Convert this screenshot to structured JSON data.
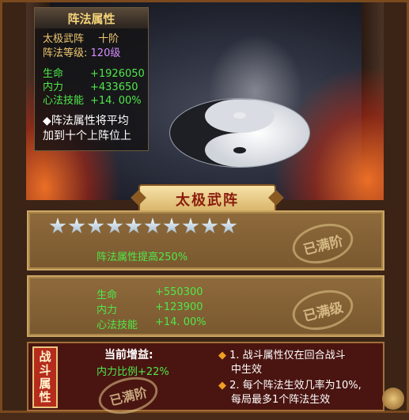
{
  "info_panel": {
    "header": "阵法属性",
    "formation_name": "太极武阵",
    "formation_rank": "十阶",
    "level_label": "阵法等级:",
    "level_value": "120级",
    "stats": [
      {
        "label": "生命",
        "value": "+1926050"
      },
      {
        "label": "内力",
        "value": "+433650"
      },
      {
        "label": "心法技能",
        "value": "+14. 00%"
      }
    ],
    "note_line1": "◆阵法属性将平均",
    "note_line2": "加到十个上阵位上"
  },
  "banner_title": "太极武阵",
  "star_panel": {
    "star_count": 10,
    "stars_filled": 10,
    "boost_text": "阵法属性提高250%",
    "stamp": "已满阶"
  },
  "level_panel": {
    "stats": [
      {
        "label": "生命",
        "value": "+550300"
      },
      {
        "label": "内力",
        "value": "+123900"
      },
      {
        "label": "心法技能",
        "value": "+14. 00%"
      }
    ],
    "stamp": "已满级"
  },
  "battle_panel": {
    "tag_chars": [
      "战",
      "斗",
      "属",
      "性"
    ],
    "current_gain_label": "当前增益:",
    "ratio_text": "内力比例+22%",
    "stamp": "已满阶",
    "notes": [
      {
        "bullet": "◆",
        "line1": "1. 战斗属性仅在回合战斗",
        "line2": "中生效"
      },
      {
        "bullet": "◆",
        "line1": "2. 每个阵法生效几率为10%,",
        "line2": "每局最多1个阵法生效"
      }
    ]
  },
  "colors": {
    "accent_gold": "#f0c871",
    "stat_green": "#4fe84a",
    "level_purple": "#d58cff",
    "banner_red": "#8b1c0c"
  }
}
